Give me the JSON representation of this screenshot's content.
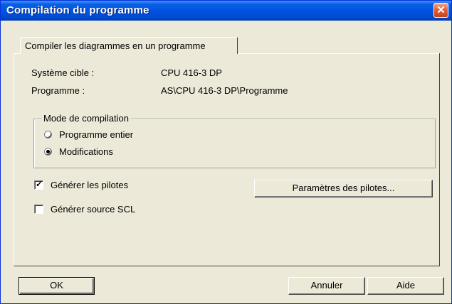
{
  "window": {
    "title": "Compilation du programme"
  },
  "tabs": [
    {
      "label": "Compiler les diagrammes en un programme"
    }
  ],
  "info": {
    "target_label": "Système cible :",
    "target_value": "CPU 416-3 DP",
    "program_label": "Programme :",
    "program_value": "AS\\CPU 416-3 DP\\Programme"
  },
  "compile_mode": {
    "title": "Mode de compilation",
    "options": [
      {
        "label": "Programme entier",
        "selected": false
      },
      {
        "label": "Modifications",
        "selected": true
      }
    ]
  },
  "options": {
    "generate_drivers": {
      "label": "Générer les pilotes",
      "checked": true
    },
    "generate_scl": {
      "label": "Générer source SCL",
      "checked": false
    },
    "driver_params_button": "Paramètres des pilotes..."
  },
  "buttons": {
    "ok": "OK",
    "cancel": "Annuler",
    "help": "Aide"
  }
}
